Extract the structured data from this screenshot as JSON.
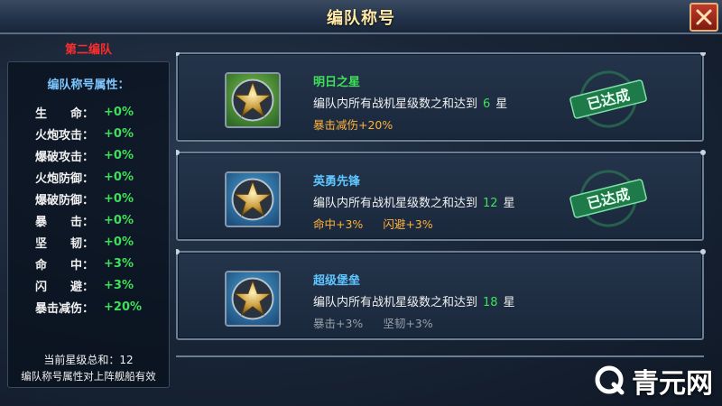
{
  "header": {
    "title": "编队称号",
    "close_icon": "close-icon"
  },
  "left_panel": {
    "team_name": "第二编队",
    "attr_title": "编队称号属性：",
    "attributes": [
      {
        "label": "生　　命：",
        "value": "+0%"
      },
      {
        "label": "火炮攻击：",
        "value": "+0%"
      },
      {
        "label": "爆破攻击：",
        "value": "+0%"
      },
      {
        "label": "火炮防御：",
        "value": "+0%"
      },
      {
        "label": "爆破防御：",
        "value": "+0%"
      },
      {
        "label": "暴　　击：",
        "value": "+0%"
      },
      {
        "label": "坚　　韧：",
        "value": "+0%"
      },
      {
        "label": "命　　中：",
        "value": "+3%"
      },
      {
        "label": "闪　　避：",
        "value": "+3%"
      },
      {
        "label": "暴击减伤：",
        "value": "+20%"
      }
    ],
    "total_stars": "当前星级总和：12",
    "note": "编队称号属性对上阵舰船有效"
  },
  "titles": [
    {
      "name": "明日之星",
      "name_color": "#3ee05a",
      "desc_prefix": "编队内所有战机星级数之和达到",
      "stars": "6",
      "desc_suffix": "星",
      "bonuses": [
        "暴击减伤+20%"
      ],
      "achieved": true,
      "badge_color": "green"
    },
    {
      "name": "英勇先锋",
      "name_color": "#5fc6ff",
      "desc_prefix": "编队内所有战机星级数之和达到",
      "stars": "12",
      "desc_suffix": "星",
      "bonuses": [
        "命中+3%",
        "闪避+3%"
      ],
      "achieved": true,
      "badge_color": "blue"
    },
    {
      "name": "超级堡垒",
      "name_color": "#5fc6ff",
      "desc_prefix": "编队内所有战机星级数之和达到",
      "stars": "18",
      "desc_suffix": "星",
      "bonuses": [
        "暴击+3%",
        "坚韧+3%"
      ],
      "achieved": false,
      "badge_color": "blue"
    }
  ],
  "stamp_text": "已达成",
  "watermark": {
    "text": "青元网",
    "icon": "q-logo-icon"
  },
  "colors": {
    "accent_green": "#3ee05a",
    "accent_orange": "#ffb13a",
    "accent_red": "#ff2d2d",
    "title_gold": "#ffe9a6"
  }
}
